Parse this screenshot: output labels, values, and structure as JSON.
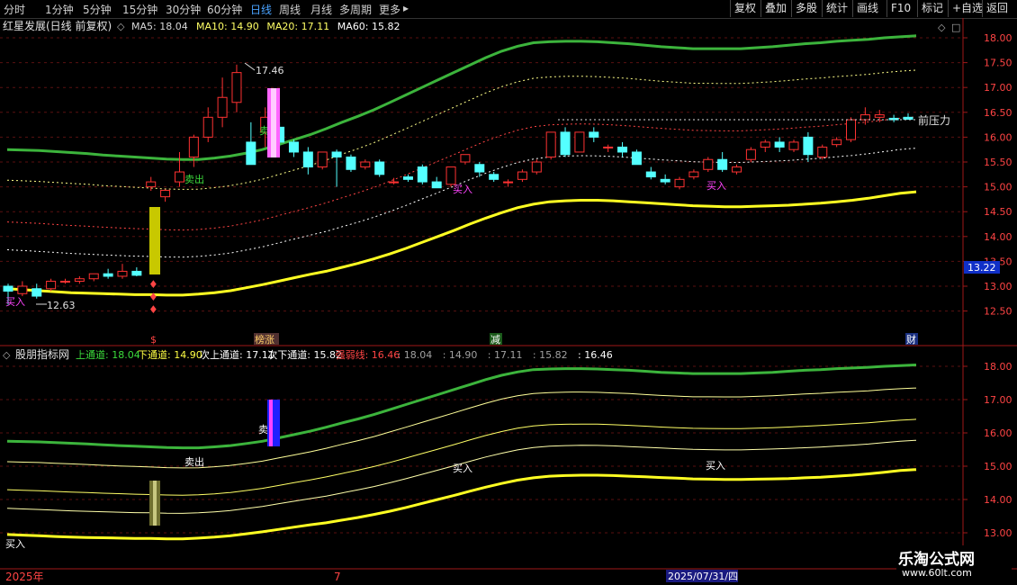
{
  "toolbar": {
    "periods": [
      "分时",
      "1分钟",
      "5分钟",
      "15分钟",
      "30分钟",
      "60分钟",
      "日线",
      "周线",
      "月线",
      "多周期",
      "更多"
    ],
    "active_period": "日线",
    "right_buttons": [
      "复权",
      "叠加",
      "多股",
      "统计",
      "画线",
      "F10",
      "标记",
      "+自选",
      "返回"
    ]
  },
  "main_panel": {
    "stock_title": "红星发展(日线 前复权)",
    "ma_legend": [
      {
        "label": "MA5: 18.04",
        "color": "#d8d8d8"
      },
      {
        "label": "MA10: 14.90",
        "color": "#ffff66"
      },
      {
        "label": "MA20: 17.11",
        "color": "#ffff66"
      },
      {
        "label": "MA60: 15.82",
        "color": "#ffffff"
      }
    ],
    "price_ticks": [
      "18.00",
      "17.50",
      "17.00",
      "16.50",
      "16.00",
      "15.50",
      "15.00",
      "14.50",
      "14.00",
      "13.50",
      "13.00",
      "12.50"
    ],
    "current_price_tag": "13.22",
    "high_label": "17.46",
    "low_label": "12.63",
    "resistance_label": "前压力",
    "buy_label": "买入",
    "sell_label": "卖出",
    "sell_short": "卖",
    "event_markers": [
      "$",
      "榜涨",
      "减",
      "财"
    ]
  },
  "indicator_panel": {
    "title": "股朋指标网",
    "values": [
      {
        "label": "上通道: 18.04",
        "color": "#3cdc3c"
      },
      {
        "label": "下通道: 14.90",
        "color": "#ffff44"
      },
      {
        "label": "次上通道: 17.11",
        "color": "#ffffff"
      },
      {
        "label": "次下通道: 15.82",
        "color": "#ffffff"
      },
      {
        "label": "强弱线: 16.46",
        "color": "#ff4444"
      },
      {
        "label": ": 18.04",
        "color": "#a0a0a0"
      },
      {
        "label": ": 14.90",
        "color": "#a0a0a0"
      },
      {
        "label": ": 17.11",
        "color": "#a0a0a0"
      },
      {
        "label": ": 15.82",
        "color": "#a0a0a0"
      },
      {
        "label": ": 16.46",
        "color": "#ffffff"
      }
    ],
    "ticks": [
      "18.00",
      "17.00",
      "16.00",
      "15.00",
      "14.00",
      "13.00"
    ],
    "buy_label": "买入",
    "sell_label": "卖出",
    "sell_short": "卖"
  },
  "time_axis": {
    "year_label": "2025年",
    "month_label": "7",
    "cursor_date": "2025/07/31/四"
  },
  "watermark": {
    "line1": "乐淘公式网",
    "line2": "www.60lt.com"
  },
  "chart_data": {
    "type": "candlestick",
    "candles": [
      {
        "o": 13.0,
        "h": 13.05,
        "l": 12.63,
        "c": 12.9
      },
      {
        "o": 12.85,
        "h": 13.1,
        "l": 12.8,
        "c": 13.0
      },
      {
        "o": 12.95,
        "h": 13.05,
        "l": 12.75,
        "c": 12.8
      },
      {
        "o": 12.95,
        "h": 13.15,
        "l": 12.9,
        "c": 13.1
      },
      {
        "o": 13.1,
        "h": 13.15,
        "l": 13.05,
        "c": 13.1
      },
      {
        "o": 13.1,
        "h": 13.2,
        "l": 13.05,
        "c": 13.15
      },
      {
        "o": 13.15,
        "h": 13.25,
        "l": 13.1,
        "c": 13.25
      },
      {
        "o": 13.25,
        "h": 13.35,
        "l": 13.15,
        "c": 13.2
      },
      {
        "o": 13.2,
        "h": 13.45,
        "l": 13.15,
        "c": 13.3
      },
      {
        "o": 13.3,
        "h": 13.38,
        "l": 13.2,
        "c": 13.22
      },
      {
        "o": 15.0,
        "h": 15.2,
        "l": 14.92,
        "c": 15.1
      },
      {
        "o": 14.8,
        "h": 14.95,
        "l": 14.7,
        "c": 14.93
      },
      {
        "o": 15.1,
        "h": 15.7,
        "l": 15.0,
        "c": 15.3
      },
      {
        "o": 15.6,
        "h": 16.05,
        "l": 15.4,
        "c": 16.0
      },
      {
        "o": 16.0,
        "h": 16.6,
        "l": 15.9,
        "c": 16.4
      },
      {
        "o": 16.4,
        "h": 17.2,
        "l": 16.2,
        "c": 16.8
      },
      {
        "o": 16.7,
        "h": 17.46,
        "l": 16.5,
        "c": 17.3
      },
      {
        "o": 15.9,
        "h": 16.3,
        "l": 15.7,
        "c": 15.45
      },
      {
        "o": 16.1,
        "h": 16.6,
        "l": 15.8,
        "c": 16.4
      },
      {
        "o": 16.2,
        "h": 16.3,
        "l": 15.8,
        "c": 15.9
      },
      {
        "o": 15.9,
        "h": 15.95,
        "l": 15.6,
        "c": 15.7
      },
      {
        "o": 15.7,
        "h": 15.8,
        "l": 15.25,
        "c": 15.4
      },
      {
        "o": 15.4,
        "h": 15.7,
        "l": 15.35,
        "c": 15.7
      },
      {
        "o": 15.7,
        "h": 15.75,
        "l": 15.0,
        "c": 15.6
      },
      {
        "o": 15.6,
        "h": 15.65,
        "l": 15.3,
        "c": 15.35
      },
      {
        "o": 15.4,
        "h": 15.55,
        "l": 15.35,
        "c": 15.5
      },
      {
        "o": 15.5,
        "h": 15.55,
        "l": 15.2,
        "c": 15.25
      },
      {
        "o": 15.1,
        "h": 15.18,
        "l": 15.05,
        "c": 15.1
      },
      {
        "o": 15.2,
        "h": 15.25,
        "l": 15.1,
        "c": 15.15
      },
      {
        "o": 15.4,
        "h": 15.45,
        "l": 15.05,
        "c": 15.1
      },
      {
        "o": 15.1,
        "h": 15.2,
        "l": 15.05,
        "c": 14.98
      },
      {
        "o": 15.05,
        "h": 15.4,
        "l": 15.0,
        "c": 15.4
      },
      {
        "o": 15.5,
        "h": 15.65,
        "l": 15.45,
        "c": 15.65
      },
      {
        "o": 15.45,
        "h": 15.5,
        "l": 15.2,
        "c": 15.3
      },
      {
        "o": 15.25,
        "h": 15.3,
        "l": 15.1,
        "c": 15.15
      },
      {
        "o": 15.1,
        "h": 15.15,
        "l": 15.0,
        "c": 15.1
      },
      {
        "o": 15.15,
        "h": 15.35,
        "l": 15.1,
        "c": 15.3
      },
      {
        "o": 15.3,
        "h": 15.55,
        "l": 15.25,
        "c": 15.5
      },
      {
        "o": 15.6,
        "h": 16.1,
        "l": 15.55,
        "c": 16.1
      },
      {
        "o": 16.1,
        "h": 16.2,
        "l": 15.6,
        "c": 15.65
      },
      {
        "o": 15.7,
        "h": 16.1,
        "l": 15.7,
        "c": 16.1
      },
      {
        "o": 16.1,
        "h": 16.2,
        "l": 15.9,
        "c": 16.0
      },
      {
        "o": 15.8,
        "h": 15.85,
        "l": 15.7,
        "c": 15.8
      },
      {
        "o": 15.8,
        "h": 15.9,
        "l": 15.6,
        "c": 15.7
      },
      {
        "o": 15.7,
        "h": 15.75,
        "l": 15.5,
        "c": 15.45
      },
      {
        "o": 15.3,
        "h": 15.4,
        "l": 15.15,
        "c": 15.2
      },
      {
        "o": 15.15,
        "h": 15.25,
        "l": 15.05,
        "c": 15.1
      },
      {
        "o": 15.0,
        "h": 15.2,
        "l": 14.95,
        "c": 15.15
      },
      {
        "o": 15.2,
        "h": 15.35,
        "l": 15.15,
        "c": 15.3
      },
      {
        "o": 15.35,
        "h": 15.6,
        "l": 15.3,
        "c": 15.55
      },
      {
        "o": 15.55,
        "h": 15.7,
        "l": 15.3,
        "c": 15.35
      },
      {
        "o": 15.3,
        "h": 15.45,
        "l": 15.25,
        "c": 15.4
      },
      {
        "o": 15.55,
        "h": 15.8,
        "l": 15.5,
        "c": 15.75
      },
      {
        "o": 15.8,
        "h": 15.95,
        "l": 15.7,
        "c": 15.9
      },
      {
        "o": 15.9,
        "h": 16.0,
        "l": 15.7,
        "c": 15.8
      },
      {
        "o": 15.75,
        "h": 15.95,
        "l": 15.7,
        "c": 15.9
      },
      {
        "o": 16.0,
        "h": 16.1,
        "l": 15.5,
        "c": 15.65
      },
      {
        "o": 15.6,
        "h": 15.85,
        "l": 15.55,
        "c": 15.8
      },
      {
        "o": 15.85,
        "h": 16.0,
        "l": 15.8,
        "c": 15.95
      },
      {
        "o": 15.95,
        "h": 16.4,
        "l": 15.9,
        "c": 16.35
      },
      {
        "o": 16.35,
        "h": 16.6,
        "l": 16.25,
        "c": 16.45
      },
      {
        "o": 16.4,
        "h": 16.55,
        "l": 16.3,
        "c": 16.45
      },
      {
        "o": 16.38,
        "h": 16.45,
        "l": 16.3,
        "c": 16.35
      },
      {
        "o": 16.4,
        "h": 16.48,
        "l": 16.35,
        "c": 16.36
      }
    ],
    "lines": {
      "upper_channel": [
        15.75,
        15.74,
        15.73,
        15.71,
        15.69,
        15.67,
        15.64,
        15.62,
        15.6,
        15.58,
        15.56,
        15.55,
        15.55,
        15.58,
        15.62,
        15.68,
        15.75,
        15.85,
        15.95,
        16.05,
        16.17,
        16.3,
        16.42,
        16.55,
        16.7,
        16.85,
        17.0,
        17.15,
        17.3,
        17.45,
        17.6,
        17.73,
        17.83,
        17.9,
        17.92,
        17.93,
        17.93,
        17.92,
        17.9,
        17.88,
        17.85,
        17.82,
        17.8,
        17.78,
        17.78,
        17.78,
        17.78,
        17.8,
        17.82,
        17.85,
        17.88,
        17.9,
        17.93,
        17.95,
        17.97,
        18.0,
        18.02,
        18.04
      ],
      "lower_channel": [
        12.95,
        12.93,
        12.91,
        12.89,
        12.87,
        12.86,
        12.85,
        12.84,
        12.83,
        12.83,
        12.82,
        12.82,
        12.84,
        12.87,
        12.91,
        12.97,
        13.03,
        13.1,
        13.17,
        13.24,
        13.3,
        13.38,
        13.46,
        13.55,
        13.65,
        13.76,
        13.88,
        14.0,
        14.12,
        14.25,
        14.37,
        14.48,
        14.58,
        14.65,
        14.7,
        14.72,
        14.73,
        14.73,
        14.72,
        14.7,
        14.68,
        14.66,
        14.64,
        14.62,
        14.61,
        14.6,
        14.6,
        14.61,
        14.62,
        14.63,
        14.65,
        14.67,
        14.7,
        14.73,
        14.77,
        14.82,
        14.87,
        14.9
      ]
    }
  }
}
